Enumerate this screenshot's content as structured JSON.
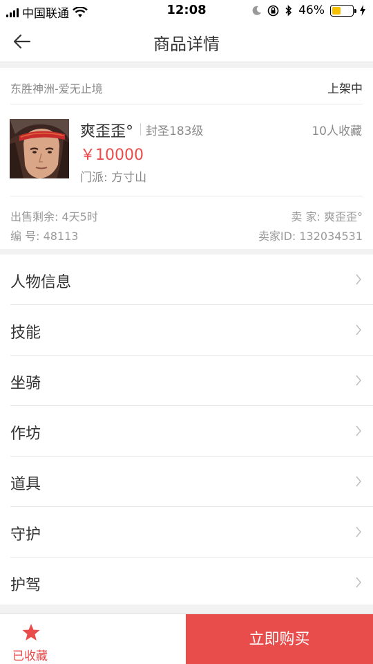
{
  "status_bar": {
    "carrier": "中国联通",
    "time": "12:08",
    "battery_percent": "46%",
    "battery_level": 0.46
  },
  "nav": {
    "title": "商品详情"
  },
  "product": {
    "server": "东胜神洲-爱无止境",
    "listing_status": "上架中",
    "name": "爽歪歪°",
    "level": "封圣183级",
    "favorites": "10人收藏",
    "price": "￥10000",
    "sect": "门派: 方寸山",
    "time_left": "出售剩余: 4天5时",
    "seller": "卖  家: 爽歪歪°",
    "serial": "编  号: 48113",
    "seller_id": "卖家ID: 132034531"
  },
  "menu": [
    {
      "label": "人物信息"
    },
    {
      "label": "技能"
    },
    {
      "label": "坐骑"
    },
    {
      "label": "作坊"
    },
    {
      "label": "道具"
    },
    {
      "label": "守护"
    },
    {
      "label": "护驾"
    }
  ],
  "bottom": {
    "favorited_label": "已收藏",
    "buy_label": "立即购买"
  },
  "colors": {
    "accent": "#e84c4b"
  }
}
